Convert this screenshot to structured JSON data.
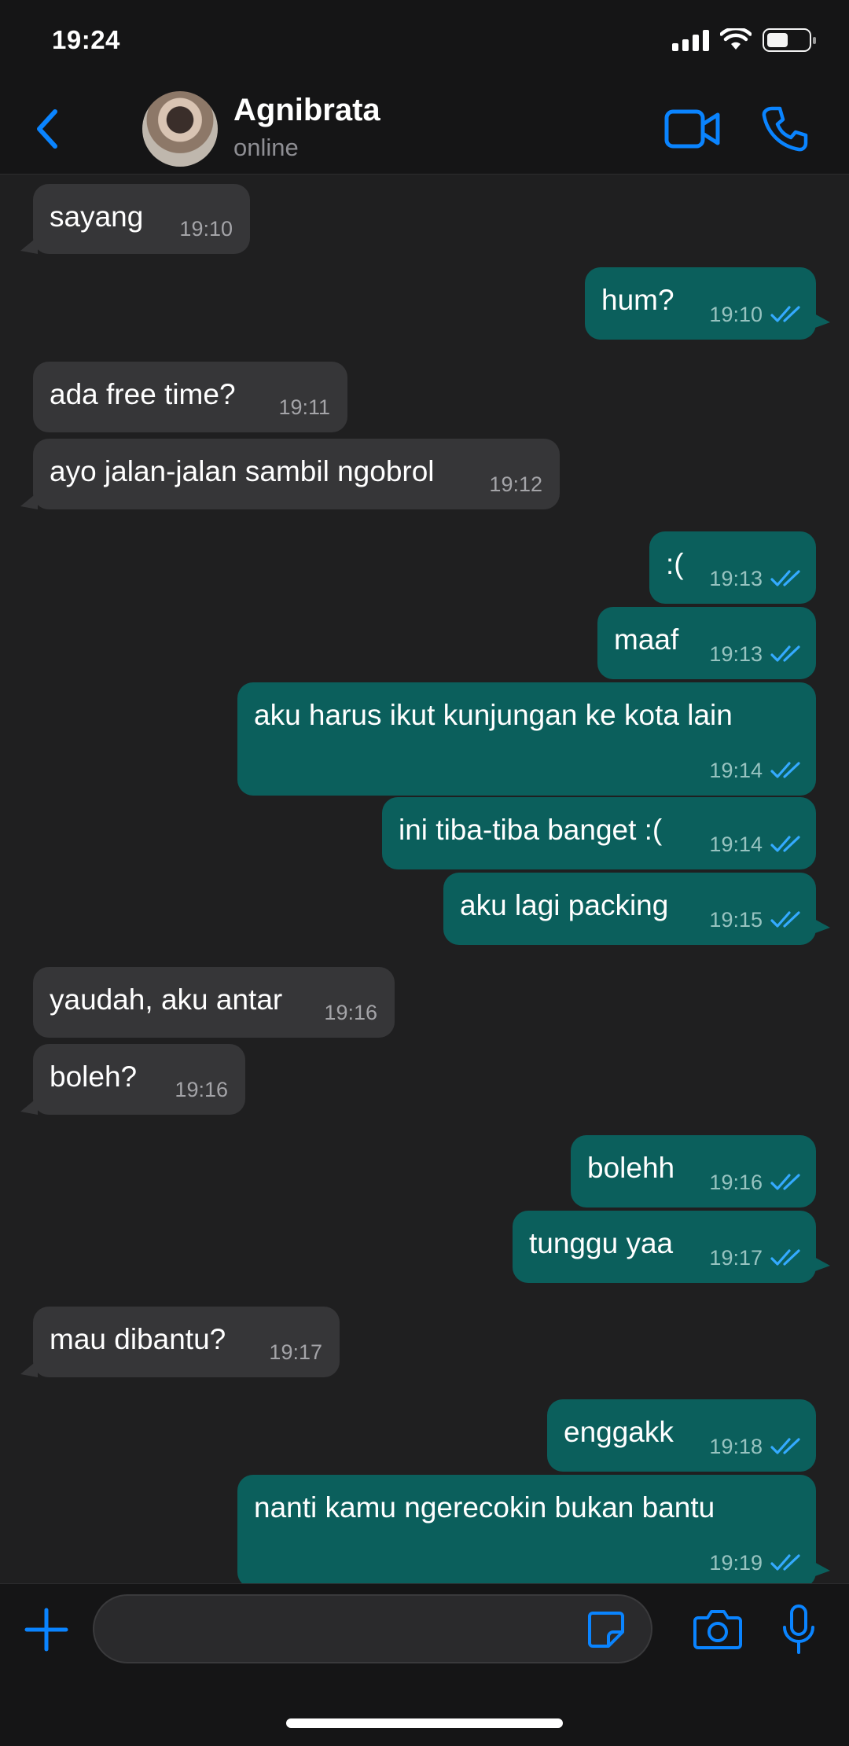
{
  "status_bar": {
    "time": "19:24",
    "icons": [
      "signal-icon",
      "wifi-icon",
      "battery-icon"
    ],
    "battery_level": 0.45
  },
  "header": {
    "back_icon": "chevron-left-icon",
    "contact_name": "Agnibrata",
    "contact_status": "online",
    "actions": [
      "video-call-icon",
      "phone-icon"
    ],
    "accent": "#0a84ff"
  },
  "messages": [
    {
      "dir": "in",
      "text": "sayang",
      "time": "19:10"
    },
    {
      "dir": "out",
      "text": "hum?",
      "time": "19:10",
      "read": true
    },
    {
      "dir": "in",
      "text": "ada free time?",
      "time": "19:11"
    },
    {
      "dir": "in",
      "text": "ayo jalan-jalan sambil ngobrol",
      "time": "19:12"
    },
    {
      "dir": "out",
      "text": ":(",
      "time": "19:13",
      "read": true
    },
    {
      "dir": "out",
      "text": "maaf",
      "time": "19:13",
      "read": true
    },
    {
      "dir": "out",
      "text": "aku harus ikut kunjungan ke kota lain",
      "time": "19:14",
      "read": true
    },
    {
      "dir": "out",
      "text": "ini tiba-tiba banget :(",
      "time": "19:14",
      "read": true
    },
    {
      "dir": "out",
      "text": "aku lagi packing",
      "time": "19:15",
      "read": true
    },
    {
      "dir": "in",
      "text": "yaudah, aku antar",
      "time": "19:16"
    },
    {
      "dir": "in",
      "text": "boleh?",
      "time": "19:16"
    },
    {
      "dir": "out",
      "text": "bolehh",
      "time": "19:16",
      "read": true
    },
    {
      "dir": "out",
      "text": "tunggu yaa",
      "time": "19:17",
      "read": true
    },
    {
      "dir": "in",
      "text": "mau dibantu?",
      "time": "19:17"
    },
    {
      "dir": "out",
      "text": "enggakk",
      "time": "19:18",
      "read": true
    },
    {
      "dir": "out",
      "text": "nanti kamu ngerecokin bukan bantu",
      "time": "19:19",
      "read": true
    }
  ],
  "composer": {
    "value": "",
    "icons": [
      "plus-icon",
      "sticker-icon",
      "camera-icon",
      "microphone-icon"
    ]
  },
  "colors": {
    "incoming_bubble": "#363638",
    "outgoing_bubble": "#0b5f5c",
    "read_ticks": "#34aaff",
    "background": "#1f1f20"
  }
}
